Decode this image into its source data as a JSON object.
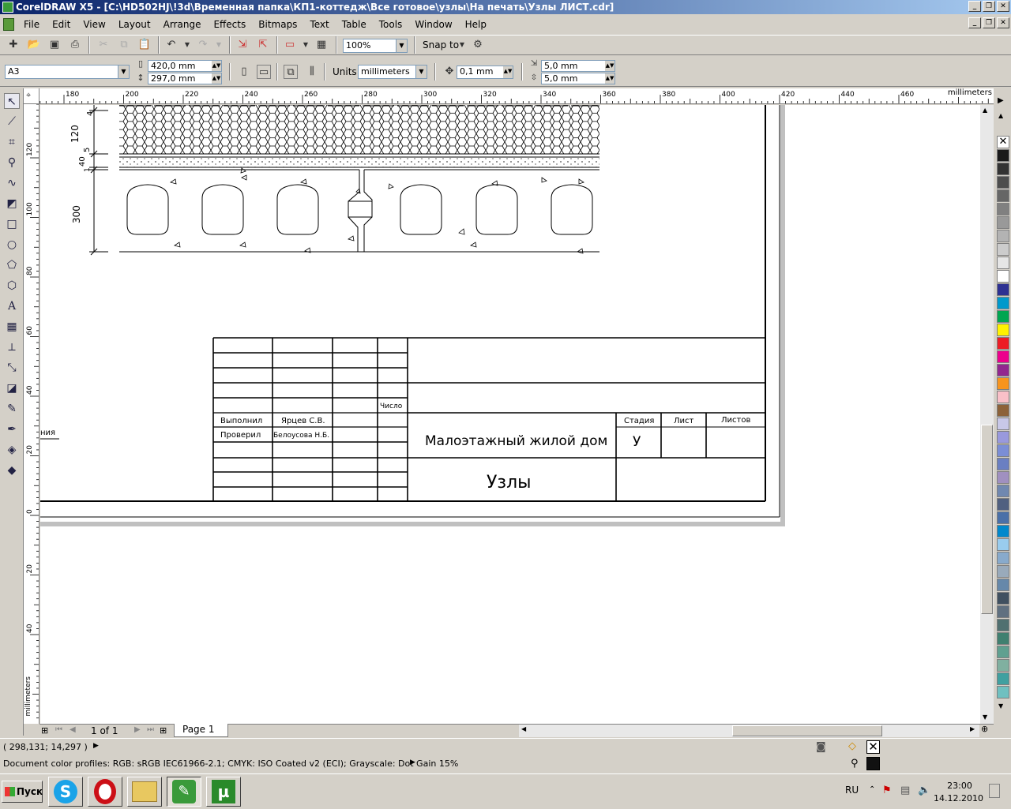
{
  "window": {
    "title": "CorelDRAW X5 - [C:\\HD502HJ\\!3d\\Временная папка\\КП1-коттедж\\Все готовое\\узлы\\На печать\\Узлы ЛИСТ.cdr]"
  },
  "menu": [
    "File",
    "Edit",
    "View",
    "Layout",
    "Arrange",
    "Effects",
    "Bitmaps",
    "Text",
    "Table",
    "Tools",
    "Window",
    "Help"
  ],
  "standard_toolbar": {
    "zoom_level": "100%",
    "snap_to": "Snap to"
  },
  "property_bar": {
    "paper_size": "A3",
    "width": "420,0 mm",
    "height": "297,0 mm",
    "units_label": "Units:",
    "units": "millimeters",
    "nudge": "0,1 mm",
    "dup_x": "5,0 mm",
    "dup_y": "5,0 mm"
  },
  "rulers": {
    "unit_label": "millimeters",
    "horizontal_ticks": [
      "180",
      "200",
      "220",
      "240",
      "260",
      "280",
      "300",
      "320",
      "340",
      "360",
      "380",
      "400",
      "420",
      "440",
      "460"
    ],
    "vertical_ticks": [
      "120",
      "100",
      "80",
      "60",
      "40",
      "20",
      "0",
      "20",
      "40"
    ],
    "vertical_unit_label": "millimeters"
  },
  "drawing": {
    "dimensions": [
      "4",
      "120",
      "5",
      "40",
      "1",
      "300"
    ],
    "title_block": {
      "chislo": "Число",
      "vypolnil_label": "Выполнил",
      "vypolnil_name": "Ярцев С.В.",
      "proveril_label": "Проверил",
      "proveril_name": "Белоусова Н.Б.",
      "project": "Малоэтажный жилой дом",
      "sheet_title": "Узлы",
      "stadia_label": "Стадия",
      "list_label": "Лист",
      "listov_label": "Листов",
      "stadia_value": "У"
    },
    "edge_fragment": "ния"
  },
  "page_nav": {
    "counter": "1 of 1",
    "tab": "Page 1"
  },
  "status": {
    "coords": "( 298,131; 14,297 )",
    "color_profiles": "Document color profiles: RGB: sRGB IEC61966-2.1; CMYK: ISO Coated v2 (ECI); Grayscale: Dot Gain 15%"
  },
  "taskbar": {
    "start": "Пуск",
    "lang": "RU",
    "time": "23:00",
    "date": "14.12.2010"
  },
  "palette_colors": [
    "#1a1a1a",
    "#333333",
    "#4d4d4d",
    "#666666",
    "#808080",
    "#999999",
    "#b3b3b3",
    "#cccccc",
    "#e6e6e6",
    "#ffffff",
    "#2e3192",
    "#0099cc",
    "#00a651",
    "#fff200",
    "#ed1c24",
    "#ec008c",
    "#92278f",
    "#f7941d",
    "#f9c0c8",
    "#8c6239",
    "#c8c8e8",
    "#9999dd",
    "#7b8ed6",
    "#6a7fc2",
    "#a090c0",
    "#7088b0",
    "#506080",
    "#4a70a8",
    "#0088cc",
    "#99ccee",
    "#88aacc",
    "#99aabb",
    "#6688aa",
    "#405060",
    "#607080",
    "#507070",
    "#408070",
    "#60a090",
    "#80b0a0",
    "#40a0a0",
    "#70c0c0"
  ]
}
